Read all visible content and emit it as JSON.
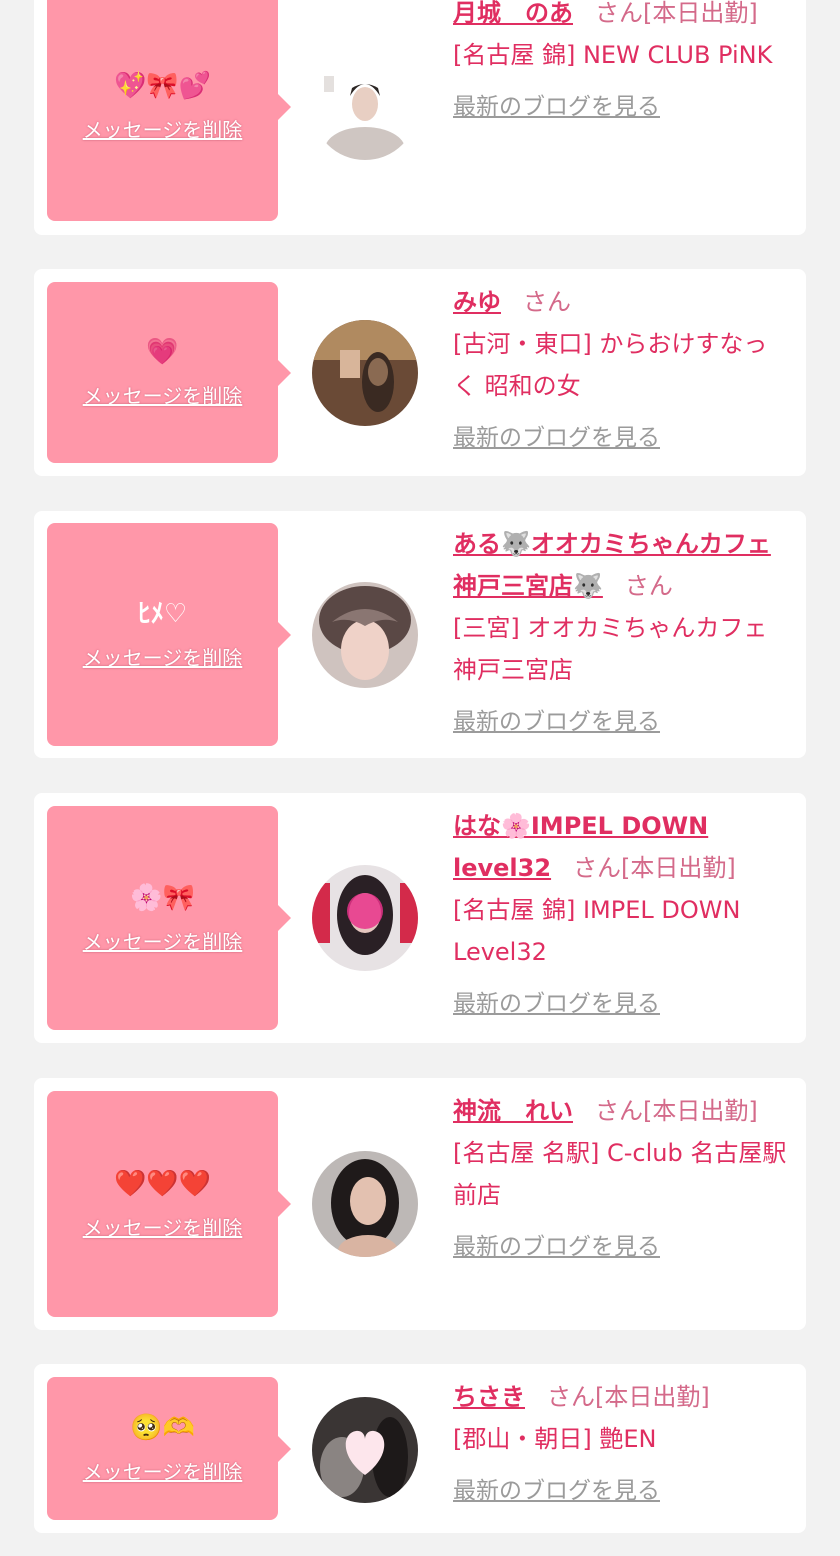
{
  "delete_label": "メッセージを削除",
  "blog_label": "最新のブログを見る",
  "colors": {
    "accent": "#e02e61",
    "bubble": "#ff97a9",
    "background": "#f2f2f2"
  },
  "entries": [
    {
      "message": "💖🎀💕",
      "name": "月城　のあ",
      "suffix": "さん[本日出勤]",
      "shop": "[名古屋 錦] NEW CLUB PiNK"
    },
    {
      "message": "💗",
      "name": "みゆ",
      "suffix": "さん",
      "shop": "[古河・東口] からおけすなっく 昭和の女"
    },
    {
      "message": "ﾋﾒ♡",
      "name": "ある🐺オオカミちゃんカフェ神戸三宮店🐺",
      "suffix": "さん",
      "shop": "[三宮] オオカミちゃんカフェ神戸三宮店"
    },
    {
      "message": "🌸🎀",
      "name": "はな🌸IMPEL DOWN level32",
      "suffix": "さん[本日出勤]",
      "shop": "[名古屋 錦] IMPEL DOWN Level32"
    },
    {
      "message": "❤️❤️❤️",
      "name": "神流　れい",
      "suffix": "さん[本日出勤]",
      "shop": "[名古屋 名駅] C-club 名古屋駅前店"
    },
    {
      "message": "🥺🫶",
      "name": "ちさき",
      "suffix": "さん[本日出勤]",
      "shop": "[郡山・朝日] 艶EN"
    }
  ]
}
